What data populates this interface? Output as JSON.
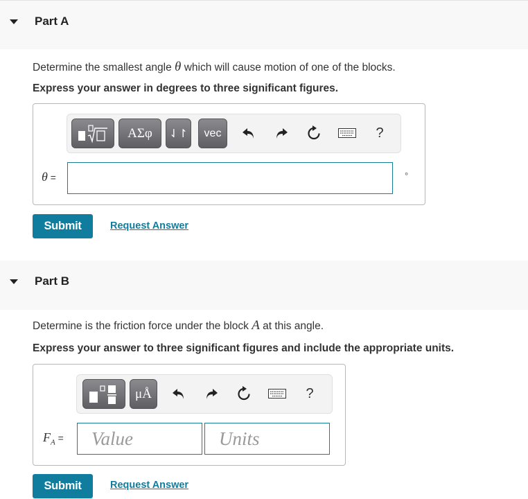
{
  "partA": {
    "title": "Part A",
    "question_pre": "Determine the smallest angle ",
    "question_var": "θ",
    "question_post": " which will cause motion of one of the blocks.",
    "instruction": "Express your answer in degrees to three significant figures.",
    "toolbar": {
      "buttons": [
        {
          "name": "templates",
          "icon": "fraction-radical-icon"
        },
        {
          "name": "greek",
          "label": "ΑΣφ"
        },
        {
          "name": "arrows",
          "label": "⇃↾"
        },
        {
          "name": "vec",
          "label": "vec"
        }
      ],
      "icons": [
        "undo-icon",
        "redo-icon",
        "reset-icon",
        "keyboard-icon",
        "help-icon"
      ],
      "help_label": "?"
    },
    "input_label_var": "θ",
    "input_label_eq": " =",
    "input_value": "",
    "unit_symbol": "°",
    "submit_label": "Submit",
    "request_label": "Request Answer"
  },
  "partB": {
    "title": "Part B",
    "question_pre": "Determine is the friction force under the block ",
    "question_var": "A",
    "question_post": " at this angle.",
    "instruction": "Express your answer to three significant figures and include the appropriate units.",
    "toolbar": {
      "buttons": [
        {
          "name": "templates",
          "icon": "templates-icon"
        },
        {
          "name": "units",
          "label": "μÅ"
        }
      ],
      "icons": [
        "undo-icon",
        "redo-icon",
        "reset-icon",
        "keyboard-icon",
        "help-icon"
      ],
      "help_label": "?"
    },
    "input_label_var": "F",
    "input_label_sub": "A",
    "input_label_eq": " =",
    "value_placeholder": "Value",
    "units_placeholder": "Units",
    "submit_label": "Submit",
    "request_label": "Request Answer"
  },
  "colors": {
    "accent": "#107d9e",
    "input_border": "#177d97",
    "header_bg": "#f8f8f8",
    "toolbar_btn": "#6e6e73"
  }
}
